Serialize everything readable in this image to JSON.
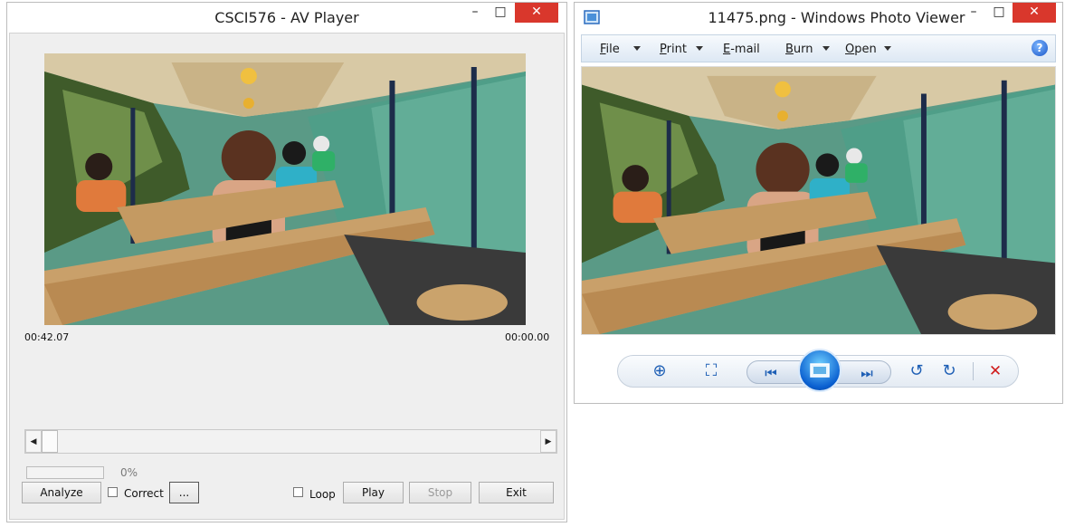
{
  "av_player": {
    "title": "CSCI576 - AV Player",
    "time_left": "00:42.07",
    "time_right": "00:00.00",
    "progress_percent": 0,
    "progress_label": "0%",
    "buttons": {
      "analyze": "Analyze",
      "browse": "...",
      "play": "Play",
      "stop": "Stop",
      "exit": "Exit"
    },
    "checkboxes": {
      "correct": "Correct",
      "loop": "Loop"
    }
  },
  "photo_viewer": {
    "title": "11475.png - Windows Photo Viewer",
    "menu": {
      "file": {
        "mnemonic": "F",
        "rest": "ile"
      },
      "print": {
        "mnemonic": "P",
        "rest": "rint"
      },
      "email": {
        "mnemonic": "E",
        "rest": "-mail"
      },
      "burn": {
        "mnemonic": "B",
        "rest": "urn"
      },
      "open": {
        "mnemonic": "O",
        "rest": "pen"
      }
    },
    "help_glyph": "?"
  },
  "caption_glyphs": {
    "minimize": "–",
    "maximize": "□",
    "close": "✕"
  },
  "toolbar_glyphs": {
    "zoom": "⊕",
    "fit": "⛶",
    "prev": "⏮",
    "next": "⏭",
    "rotate_ccw": "↺",
    "rotate_cw": "↻",
    "delete": "✕"
  },
  "scroll_glyphs": {
    "left": "◀",
    "right": "▶"
  },
  "colors": {
    "close_red": "#d9372c",
    "accent_blue": "#1e5fb5",
    "delete_red": "#d01c1c"
  }
}
